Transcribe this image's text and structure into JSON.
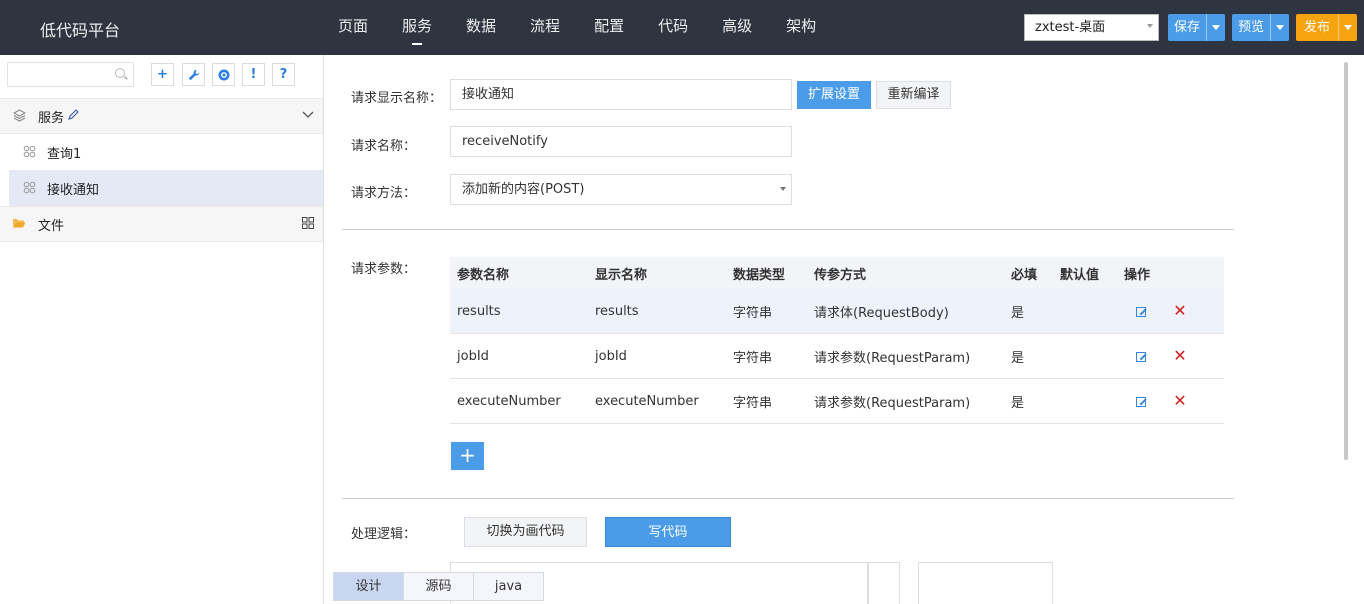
{
  "app": {
    "title": "低代码平台"
  },
  "nav": [
    {
      "label": "页面"
    },
    {
      "label": "服务",
      "active": true
    },
    {
      "label": "数据"
    },
    {
      "label": "流程"
    },
    {
      "label": "配置"
    },
    {
      "label": "代码"
    },
    {
      "label": "高级"
    },
    {
      "label": "架构"
    }
  ],
  "toolbar": {
    "app_select": "zxtest-桌面",
    "save": "保存",
    "preview": "预览",
    "publish": "发布",
    "colors": {
      "primary": "#4a9ce8",
      "publish": "#f5a30f",
      "topbar": "#2e3440"
    }
  },
  "sidebar": {
    "search_placeholder": "",
    "tools": [
      {
        "icon": "plus-icon",
        "glyph": "+"
      },
      {
        "icon": "wrench-icon",
        "glyph": "🔧"
      },
      {
        "icon": "refresh-icon",
        "glyph": "◉"
      },
      {
        "icon": "exclamation-icon",
        "glyph": "!"
      },
      {
        "icon": "help-icon",
        "glyph": "?"
      }
    ],
    "group_service": "服务",
    "items": [
      {
        "label": "查询1"
      },
      {
        "label": "接收通知",
        "selected": true
      }
    ],
    "group_file": "文件"
  },
  "form": {
    "display_name_label": "请求显示名称：",
    "display_name_value": "接收通知",
    "ext_settings": "扩展设置",
    "recompile": "重新编译",
    "name_label": "请求名称：",
    "name_value": "receiveNotify",
    "method_label": "请求方法：",
    "method_value": "添加新的内容(POST)",
    "params_label": "请求参数：",
    "logic_label": "处理逻辑：",
    "switch_visual": "切换为画代码",
    "write_code": "写代码"
  },
  "params_table": {
    "headers": [
      "参数名称",
      "显示名称",
      "数据类型",
      "传参方式",
      "必填",
      "默认值",
      "操作"
    ],
    "rows": [
      {
        "name": "results",
        "display": "results",
        "type": "字符串",
        "mode": "请求体(RequestBody)",
        "required": "是",
        "default": ""
      },
      {
        "name": "jobId",
        "display": "jobId",
        "type": "字符串",
        "mode": "请求参数(RequestParam)",
        "required": "是",
        "default": ""
      },
      {
        "name": "executeNumber",
        "display": "executeNumber",
        "type": "字符串",
        "mode": "请求参数(RequestParam)",
        "required": "是",
        "default": ""
      }
    ],
    "add_glyph": "+"
  },
  "bottom_tabs": [
    {
      "label": "设计",
      "active": true
    },
    {
      "label": "源码"
    },
    {
      "label": "java"
    }
  ]
}
